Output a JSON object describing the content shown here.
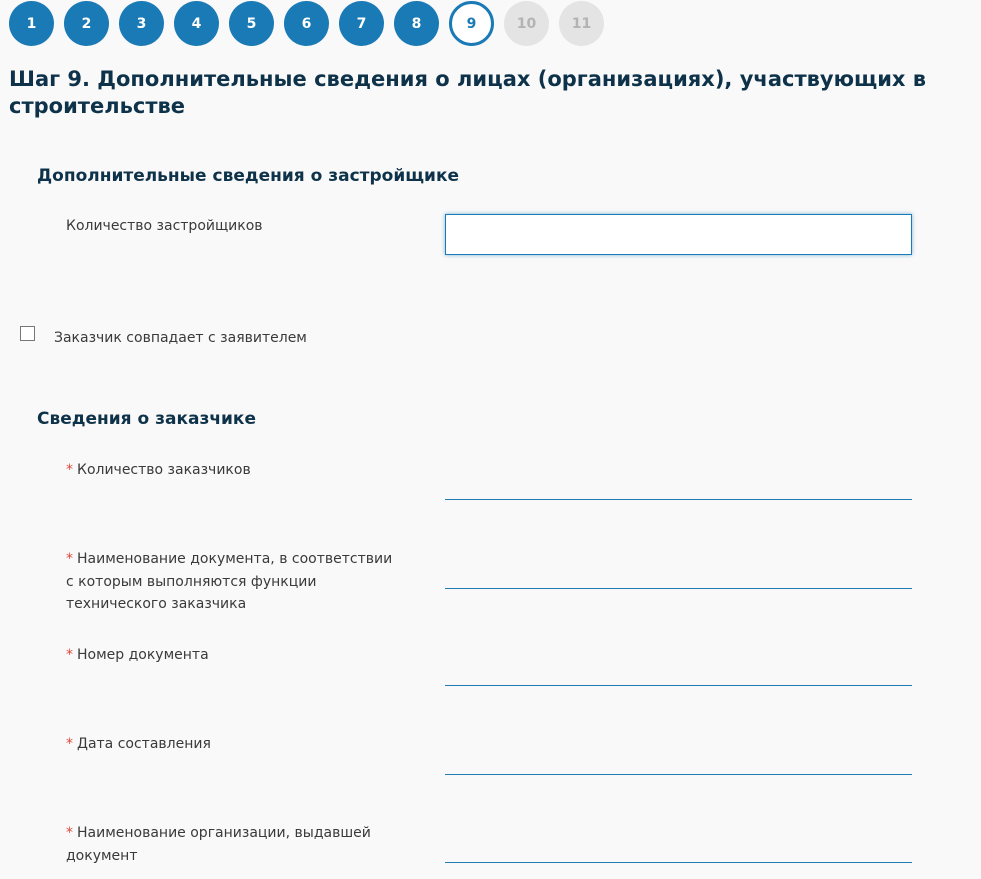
{
  "steps": [
    "1",
    "2",
    "3",
    "4",
    "5",
    "6",
    "7",
    "8",
    "9",
    "10",
    "11"
  ],
  "current_step": "9",
  "colors": {
    "step_done": "#1a7ab5",
    "step_future": "#e4e4e4",
    "title": "#0d3249",
    "required_marker": "#e0483a",
    "input_border": "#1f7db4"
  },
  "page_title": "Шаг 9. Дополнительные сведения о лицах (организациях), участвующих в строительстве",
  "developer_section": {
    "title": "Дополнительные сведения о застройщике",
    "count_label": "Количество застройщиков",
    "count_value": ""
  },
  "customer_same_checkbox": {
    "label": "Заказчик совпадает с заявителем",
    "checked": false
  },
  "customer_section": {
    "title": "Сведения о заказчике",
    "required_marker": "*",
    "fields": [
      {
        "label": "Количество заказчиков",
        "value": ""
      },
      {
        "label": "Наименование документа, в соответствии с которым выполняются функции технического заказчика",
        "value": ""
      },
      {
        "label": "Номер документа",
        "value": ""
      },
      {
        "label": "Дата составления",
        "value": ""
      },
      {
        "label": "Наименование организации, выдавшей документ",
        "value": ""
      }
    ]
  }
}
